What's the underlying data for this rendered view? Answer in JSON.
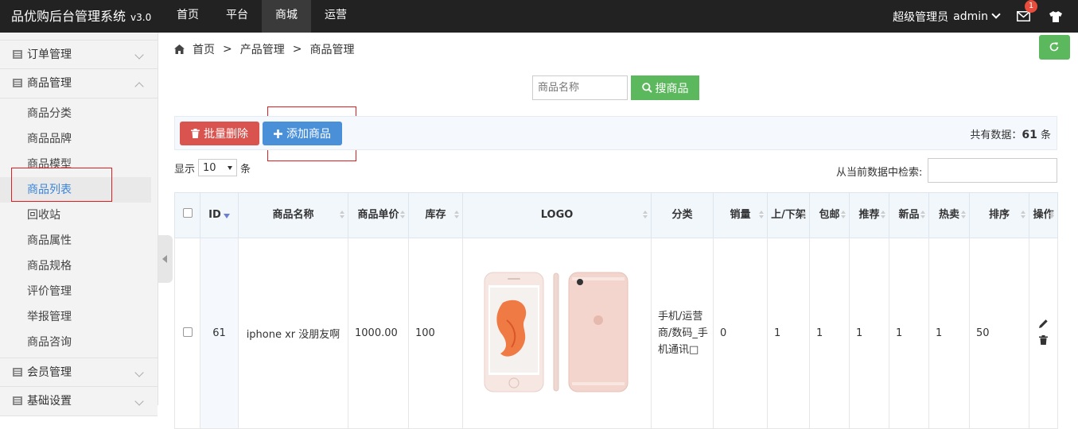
{
  "app": {
    "title": "品优购后台管理系统",
    "version": "v3.0"
  },
  "topnav": [
    "首页",
    "平台",
    "商城",
    "运营"
  ],
  "user": {
    "role": "超级管理员",
    "name": "admin",
    "mail_badge": "1"
  },
  "sidebar": {
    "order_group": "订单管理",
    "product_group": "商品管理",
    "product_items": [
      "商品分类",
      "商品品牌",
      "商品模型",
      "商品列表",
      "回收站",
      "商品属性",
      "商品规格",
      "评价管理",
      "举报管理",
      "商品咨询"
    ],
    "member_group": "会员管理",
    "base_group": "基础设置"
  },
  "breadcrumb": [
    "首页",
    ">",
    "产品管理",
    ">",
    "商品管理"
  ],
  "search": {
    "placeholder": "商品名称",
    "button": "搜商品"
  },
  "toolbar": {
    "delete_label": "批量删除",
    "add_label": "添加商品",
    "total_prefix": "共有数据：",
    "total_count": "61",
    "total_suffix": " 条"
  },
  "length": {
    "prefix": "显示",
    "value": "10",
    "suffix": "条"
  },
  "filter": {
    "label": "从当前数据中检索:"
  },
  "table": {
    "headers": [
      "ID",
      "商品名称",
      "商品单价",
      "库存",
      "LOGO",
      "分类",
      "销量",
      "上/下架",
      "包邮",
      "推荐",
      "新品",
      "热卖",
      "排序",
      "操作"
    ],
    "row": {
      "id": "61",
      "name": "iphone xr 没朋友啊",
      "price": "1000.00",
      "stock": "100",
      "category": "手机/运营商/数码_手机通讯□",
      "sales": "0",
      "onsale": "1",
      "free_ship": "1",
      "recommend": "1",
      "new": "1",
      "hot": "1",
      "sort": "50"
    }
  }
}
